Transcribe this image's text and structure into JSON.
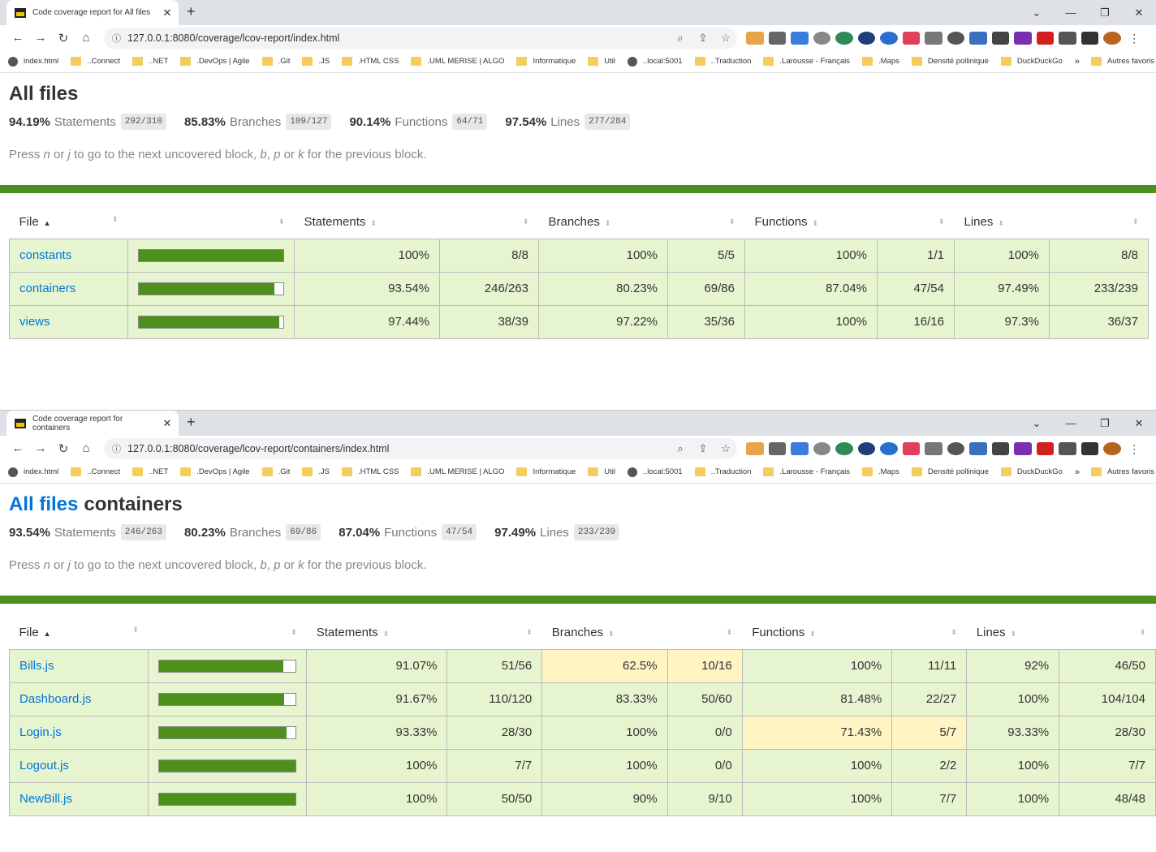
{
  "windows": [
    {
      "tab_title": "Code coverage report for All files",
      "url": "127.0.0.1:8080/coverage/lcov-report/index.html",
      "heading_link": "",
      "heading": "All files",
      "summary": {
        "statements": {
          "pct": "94.19%",
          "label": "Statements",
          "frac": "292/310"
        },
        "branches": {
          "pct": "85.83%",
          "label": "Branches",
          "frac": "109/127"
        },
        "functions": {
          "pct": "90.14%",
          "label": "Functions",
          "frac": "64/71"
        },
        "lines": {
          "pct": "97.54%",
          "label": "Lines",
          "frac": "277/284"
        }
      },
      "rows": [
        {
          "file": "constants",
          "coverage": 1.0,
          "st_pct": "100%",
          "st_frac": "8/8",
          "br_pct": "100%",
          "br_frac": "5/5",
          "fn_pct": "100%",
          "fn_frac": "1/1",
          "ln_pct": "100%",
          "ln_frac": "8/8",
          "br_low": false,
          "fn_low": false
        },
        {
          "file": "containers",
          "coverage": 0.9354,
          "st_pct": "93.54%",
          "st_frac": "246/263",
          "br_pct": "80.23%",
          "br_frac": "69/86",
          "fn_pct": "87.04%",
          "fn_frac": "47/54",
          "ln_pct": "97.49%",
          "ln_frac": "233/239",
          "br_low": false,
          "fn_low": false
        },
        {
          "file": "views",
          "coverage": 0.9744,
          "st_pct": "97.44%",
          "st_frac": "38/39",
          "br_pct": "97.22%",
          "br_frac": "35/36",
          "fn_pct": "100%",
          "fn_frac": "16/16",
          "ln_pct": "97.3%",
          "ln_frac": "36/37",
          "br_low": false,
          "fn_low": false
        }
      ]
    },
    {
      "tab_title": "Code coverage report for containers",
      "url": "127.0.0.1:8080/coverage/lcov-report/containers/index.html",
      "heading_link": "All files",
      "heading": "containers",
      "summary": {
        "statements": {
          "pct": "93.54%",
          "label": "Statements",
          "frac": "246/263"
        },
        "branches": {
          "pct": "80.23%",
          "label": "Branches",
          "frac": "69/86"
        },
        "functions": {
          "pct": "87.04%",
          "label": "Functions",
          "frac": "47/54"
        },
        "lines": {
          "pct": "97.49%",
          "label": "Lines",
          "frac": "233/239"
        }
      },
      "rows": [
        {
          "file": "Bills.js",
          "coverage": 0.9107,
          "st_pct": "91.07%",
          "st_frac": "51/56",
          "br_pct": "62.5%",
          "br_frac": "10/16",
          "fn_pct": "100%",
          "fn_frac": "11/11",
          "ln_pct": "92%",
          "ln_frac": "46/50",
          "br_low": true,
          "fn_low": false
        },
        {
          "file": "Dashboard.js",
          "coverage": 0.9167,
          "st_pct": "91.67%",
          "st_frac": "110/120",
          "br_pct": "83.33%",
          "br_frac": "50/60",
          "fn_pct": "81.48%",
          "fn_frac": "22/27",
          "ln_pct": "100%",
          "ln_frac": "104/104",
          "br_low": false,
          "fn_low": false
        },
        {
          "file": "Login.js",
          "coverage": 0.9333,
          "st_pct": "93.33%",
          "st_frac": "28/30",
          "br_pct": "100%",
          "br_frac": "0/0",
          "fn_pct": "71.43%",
          "fn_frac": "5/7",
          "ln_pct": "93.33%",
          "ln_frac": "28/30",
          "br_low": false,
          "fn_low": true
        },
        {
          "file": "Logout.js",
          "coverage": 1.0,
          "st_pct": "100%",
          "st_frac": "7/7",
          "br_pct": "100%",
          "br_frac": "0/0",
          "fn_pct": "100%",
          "fn_frac": "2/2",
          "ln_pct": "100%",
          "ln_frac": "7/7",
          "br_low": false,
          "fn_low": false
        },
        {
          "file": "NewBill.js",
          "coverage": 1.0,
          "st_pct": "100%",
          "st_frac": "50/50",
          "br_pct": "90%",
          "br_frac": "9/10",
          "fn_pct": "100%",
          "fn_frac": "7/7",
          "ln_pct": "100%",
          "ln_frac": "48/48",
          "br_low": false,
          "fn_low": false
        }
      ]
    }
  ],
  "columns": {
    "file": "File",
    "statements": "Statements",
    "branches": "Branches",
    "functions": "Functions",
    "lines": "Lines"
  },
  "hint": {
    "press": "Press",
    "n": "n",
    "or1": "or",
    "j": "j",
    "mid": "to go to the next uncovered block,",
    "b": "b",
    "comma": ",",
    "p": "p",
    "or2": "or",
    "k": "k",
    "end": "for the previous block."
  },
  "bookmarks": [
    "index.html",
    "..Connect",
    "..NET",
    ".DevOps | Agile",
    ".Git",
    ".JS",
    ".HTML CSS",
    ".UML MERISE | ALGO",
    "Informatique",
    "Util",
    "..local:5001",
    "..Traduction",
    ".Larousse - Français",
    ".Maps",
    "Densité pollinique",
    "DuckDuckGo"
  ],
  "bookmarks_other": "Autres favoris",
  "colors": {
    "accent_green": "#4d901b",
    "high_bg": "#e6f5d0",
    "medium_bg": "#fff4c2",
    "link": "#0074d9"
  }
}
